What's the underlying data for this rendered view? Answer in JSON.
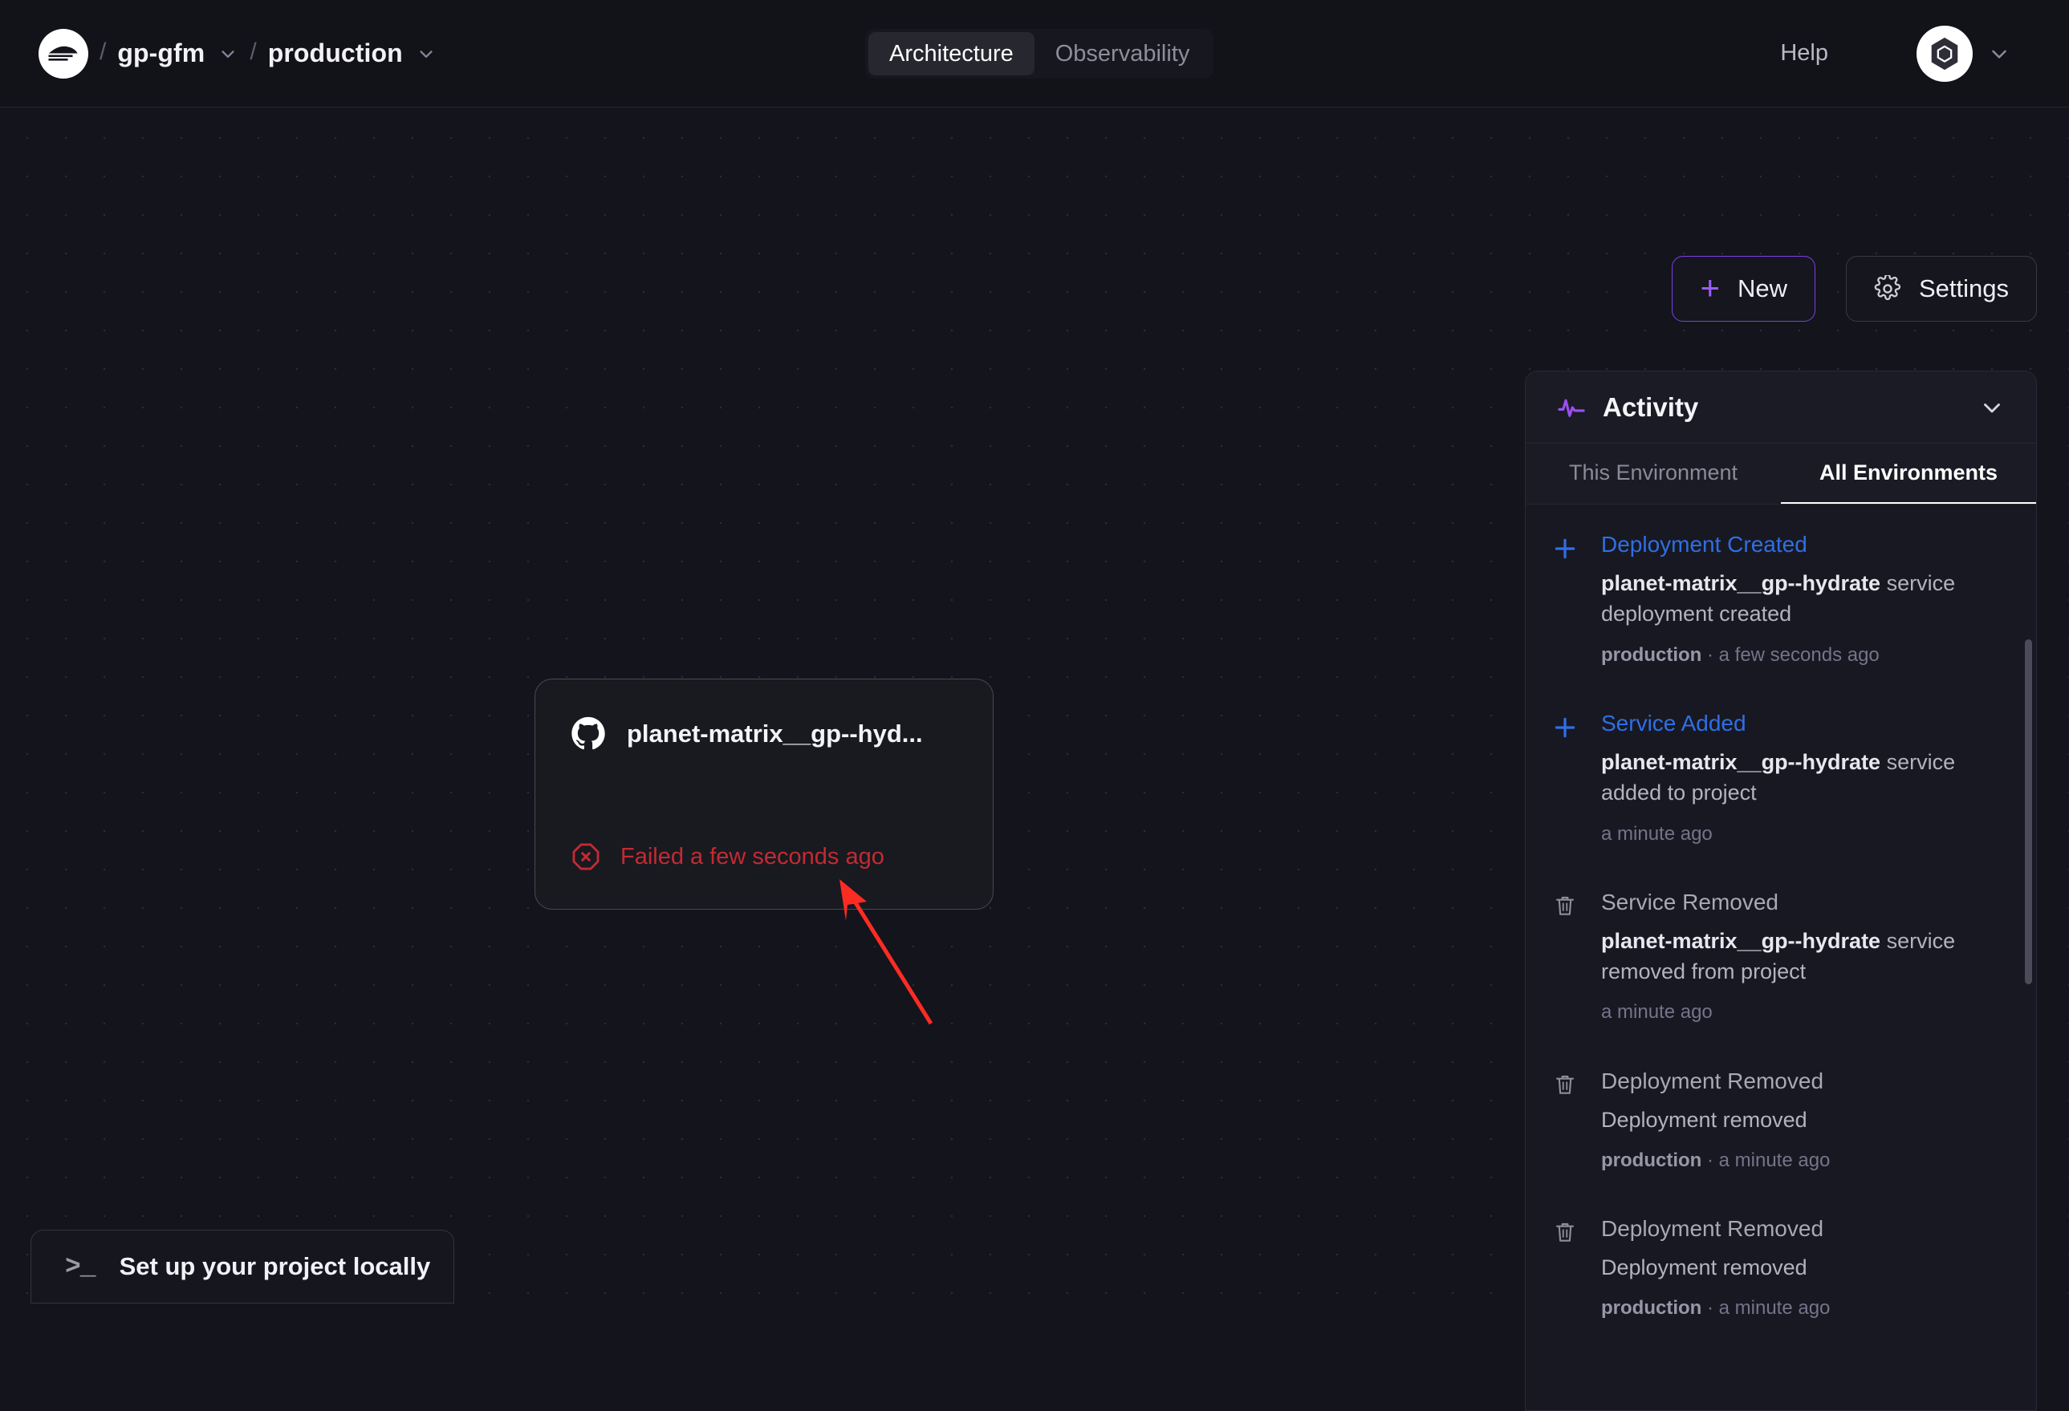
{
  "header": {
    "logo_icon": "railway-logo-icon",
    "breadcrumb": {
      "separator": "/",
      "project": "gp-gfm",
      "environment": "production"
    },
    "tabs": [
      {
        "label": "Architecture",
        "active": true
      },
      {
        "label": "Observability",
        "active": false
      }
    ],
    "help_label": "Help",
    "avatar_icon": "user-avatar-hexagon-icon",
    "avatar_chevron_icon": "chevron-down-icon"
  },
  "toolbar": {
    "new_label": "New",
    "new_icon": "plus-icon",
    "settings_label": "Settings",
    "settings_icon": "gear-icon"
  },
  "canvas": {
    "service_card": {
      "source_icon": "github-icon",
      "name": "planet-matrix__gp--hyd...",
      "status_icon": "error-octagon-x-icon",
      "status_text": "Failed a few seconds ago",
      "status_color": "#c22b32"
    },
    "setup_locally": {
      "icon": "terminal-prompt-icon",
      "icon_glyph": ">_",
      "label": "Set up your project locally"
    },
    "annotation": {
      "type": "arrow",
      "color": "#fb2c24"
    }
  },
  "activity": {
    "icon": "activity-pulse-icon",
    "title": "Activity",
    "collapse_icon": "chevron-down-icon",
    "tabs": [
      {
        "label": "This Environment",
        "active": false
      },
      {
        "label": "All Environments",
        "active": true
      }
    ],
    "items": [
      {
        "icon": "plus-icon",
        "icon_kind": "plus",
        "title": "Deployment Created",
        "title_kind": "created",
        "subject": "planet-matrix__gp--hydrate",
        "desc_tail": " service deployment created",
        "meta_env": "production",
        "meta_sep": " · ",
        "meta_time": "a few seconds ago"
      },
      {
        "icon": "plus-icon",
        "icon_kind": "plus",
        "title": "Service Added",
        "title_kind": "created",
        "subject": "planet-matrix__gp--hydrate",
        "desc_tail": " service added to project",
        "meta_env": "",
        "meta_sep": "",
        "meta_time": "a minute ago"
      },
      {
        "icon": "trash-icon",
        "icon_kind": "trash",
        "title": "Service Removed",
        "title_kind": "removed",
        "subject": "planet-matrix__gp--hydrate",
        "desc_tail": " service removed from project",
        "meta_env": "",
        "meta_sep": "",
        "meta_time": "a minute ago"
      },
      {
        "icon": "trash-icon",
        "icon_kind": "trash",
        "title": "Deployment Removed",
        "title_kind": "removed",
        "subject": "",
        "desc_tail": "Deployment removed",
        "meta_env": "production",
        "meta_sep": " · ",
        "meta_time": "a minute ago"
      },
      {
        "icon": "trash-icon",
        "icon_kind": "trash",
        "title": "Deployment Removed",
        "title_kind": "removed",
        "subject": "",
        "desc_tail": "Deployment removed",
        "meta_env": "production",
        "meta_sep": " · ",
        "meta_time": "a minute ago"
      }
    ]
  },
  "colors": {
    "background": "#14141c",
    "panel": "#181822",
    "accent_purple": "#7b3fe4",
    "accent_blue": "#2f6fe4",
    "danger_red": "#c22b32",
    "annotation_red": "#fb2c24"
  }
}
